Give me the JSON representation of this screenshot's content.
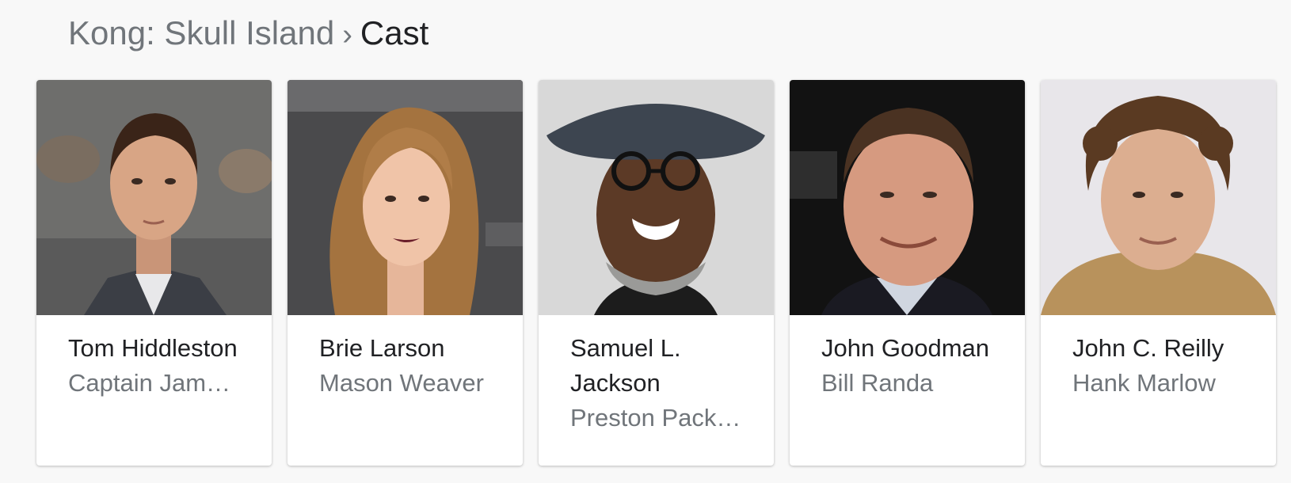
{
  "breadcrumb": {
    "parent": "Kong: Skull Island",
    "separator": "›",
    "current": "Cast"
  },
  "cast": [
    {
      "name_line1": "Tom",
      "name_line2": "Hiddleston",
      "role": "Captain Jam…"
    },
    {
      "name_line1": "Brie Larson",
      "name_line2": "",
      "role": "Mason Weaver"
    },
    {
      "name_line1": "Samuel L.",
      "name_line2": "Jackson",
      "role": "Preston Pack…"
    },
    {
      "name_line1": "John",
      "name_line2": "Goodman",
      "role": "Bill Randa"
    },
    {
      "name_line1": "John C. Reilly",
      "name_line2": "",
      "role": "Hank Marlow"
    }
  ],
  "colors": {
    "background": "#f8f8f8",
    "card": "#ffffff",
    "name_text": "#202124",
    "secondary_text": "#70757a"
  }
}
